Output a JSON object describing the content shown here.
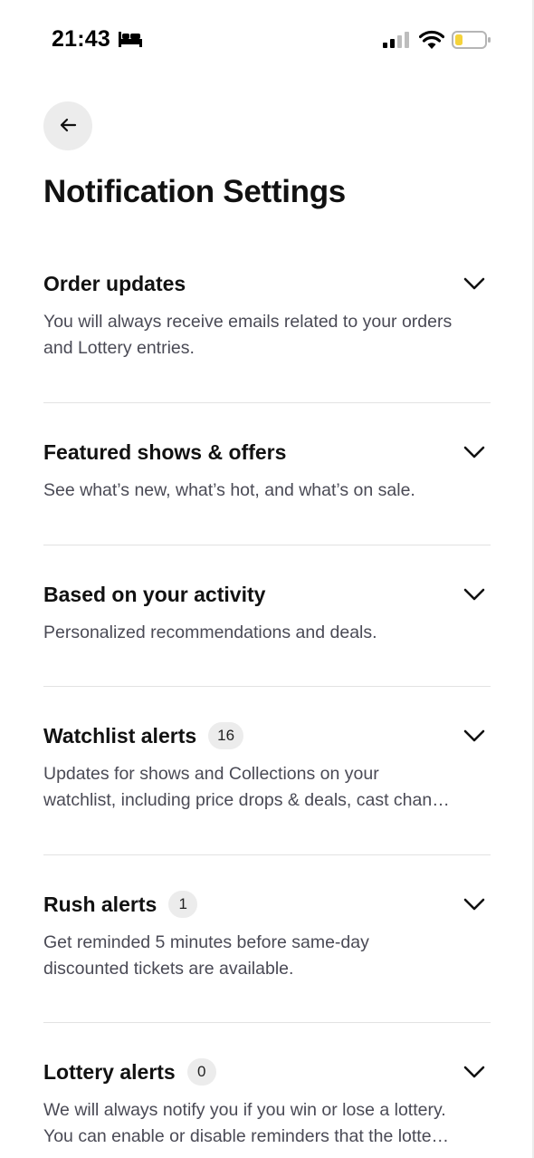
{
  "status_bar": {
    "time": "21:43"
  },
  "page": {
    "title": "Notification Settings"
  },
  "settings": [
    {
      "title": "Order updates",
      "badge": "",
      "description_lines": [
        "You will always receive emails related to your orders",
        "and Lottery entries."
      ]
    },
    {
      "title": "Featured shows & offers",
      "badge": "",
      "description_lines": [
        "See what’s new, what’s hot, and what’s on sale.",
        ""
      ]
    },
    {
      "title": "Based on your activity",
      "badge": "",
      "description_lines": [
        "Personalized recommendations and deals.",
        ""
      ]
    },
    {
      "title": "Watchlist alerts",
      "badge": "16",
      "description_lines": [
        "Updates for shows and Collections on your",
        "watchlist, including price drops & deals, cast chan…"
      ]
    },
    {
      "title": "Rush alerts",
      "badge": "1",
      "description_lines": [
        "Get reminded 5 minutes before same-day",
        "discounted tickets are available."
      ]
    },
    {
      "title": "Lottery alerts",
      "badge": "0",
      "description_lines": [
        "We will always notify you if you win or lose a lottery.",
        "You can enable or disable reminders that the lotte…"
      ]
    }
  ],
  "colors": {
    "background": "#ffffff",
    "text_primary": "#111111",
    "text_secondary": "#4a4a55",
    "badge_bg": "#ececec",
    "divider": "#e2e2e2",
    "battery_level": "#f5d33a"
  },
  "icons": {
    "back": "arrow-left-icon",
    "expand": "chevron-down-icon",
    "sleep_focus": "bed-icon",
    "signal": "cellular-signal-icon",
    "wifi": "wifi-icon",
    "battery": "battery-icon"
  },
  "battery_level_fraction": 0.2
}
